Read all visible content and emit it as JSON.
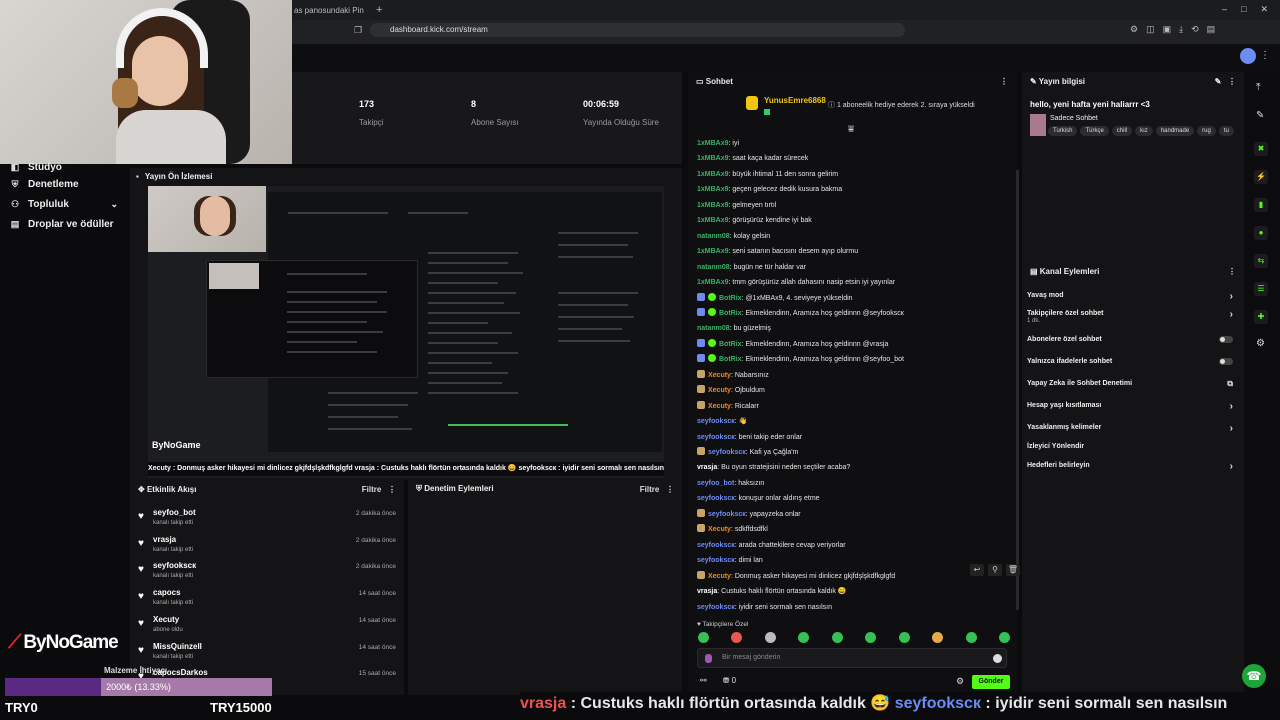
{
  "browser": {
    "tab_title": "as panosundaki Pin",
    "new_tab": "+",
    "url": "dashboard.kick.com/stream",
    "window_controls": [
      "–",
      "□",
      "✕"
    ]
  },
  "nav": {
    "items": [
      {
        "label": "Stüdyo",
        "icon": "studio-icon"
      },
      {
        "label": "Denetleme",
        "icon": "shield-icon"
      },
      {
        "label": "Topluluk",
        "icon": "people-icon"
      },
      {
        "label": "Droplar ve ödüller",
        "icon": "gift-icon"
      }
    ]
  },
  "stats": [
    {
      "value": "173",
      "label": "Takipçi"
    },
    {
      "value": "8",
      "label": "Abone Sayısı"
    },
    {
      "value": "00:06:59",
      "label": "Yayında Olduğu Süre"
    }
  ],
  "preview": {
    "title": "Yayın Ön İzlemesi",
    "logo": "ByNoGame",
    "ticker": "Xecuty : Donmuş asker hikayesi mi dinlicez gkjfdşlşkdfkglgfd  vrasja : Custuks haklı flörtün ortasında kaldık 😄  seyfookscк : iyidir seni sormalı sen nasılsın"
  },
  "activity": {
    "title": "Etkinlik Akışı",
    "filter": "Filtre",
    "items": [
      {
        "name": "seyfoo_bot",
        "sub": "kanalı takip etti",
        "time": "2 dakika önce"
      },
      {
        "name": "vrasja",
        "sub": "kanalı takip etti",
        "time": "2 dakika önce"
      },
      {
        "name": "seyfookscк",
        "sub": "kanalı takip etti",
        "time": "2 dakika önce"
      },
      {
        "name": "capocs",
        "sub": "kanalı takip etti",
        "time": "14 saat önce"
      },
      {
        "name": "Xecuty",
        "sub": "abone oldu",
        "time": "14 saat önce"
      },
      {
        "name": "MissQuinzell",
        "sub": "kanalı takip etti",
        "time": "14 saat önce"
      },
      {
        "name": "capocsDarkos",
        "sub": "",
        "time": "15 saat önce"
      }
    ]
  },
  "moderation": {
    "title": "Denetim Eylemleri",
    "filter": "Filtre"
  },
  "goal": {
    "label": "Malzeme İhtiyacı",
    "text": "2000₺ (13.33%)",
    "progress": 0.1333,
    "min": "TRY0",
    "max": "TRY15000"
  },
  "brand": {
    "logo": "ByNoGame",
    "mark": "⟋"
  },
  "chat": {
    "title": "Sohbet",
    "pinned_user": "YunusEmre6868",
    "pinned_msg": "1 aboneelik hediye ederek 2. sıraya yükseldi",
    "messages": [
      {
        "user": "1xMBAx9",
        "color": "u-green",
        "text": "iyi"
      },
      {
        "user": "1xMBAx9",
        "color": "u-green",
        "text": "saat kaça kadar sürecek"
      },
      {
        "user": "1xMBAx9",
        "color": "u-green",
        "text": "büyük ihtimal 11 den sonra gelirim"
      },
      {
        "user": "1xMBAx9",
        "color": "u-green",
        "text": "geçen gelecez dedik kusura bakma"
      },
      {
        "user": "1xMBAx9",
        "color": "u-green",
        "text": "gelmeyen tırtıl"
      },
      {
        "user": "1xMBAx9",
        "color": "u-green",
        "text": "görüşürüz kendine iyi bak"
      },
      {
        "user": "natanm08",
        "color": "u-green",
        "text": "kolay gelsin"
      },
      {
        "user": "1xMBAx9",
        "color": "u-green",
        "text": "seni satanın bacısını desem ayıp olurmu"
      },
      {
        "user": "natanm08",
        "color": "u-green",
        "text": "bugün ne tür haldar var"
      },
      {
        "user": "1xMBAx9",
        "color": "u-green",
        "text": "tmm görüşürüz allah dahasını nasip etsin iyi yayınlar"
      },
      {
        "user": "BotRix",
        "color": "u-green",
        "text": "@1xMBAx9, 4. seviyeye yükseldin",
        "badge": true
      },
      {
        "user": "BotRix",
        "color": "u-green",
        "text": "Ekmeklendinn, Aramıza hoş geldinnn @seyfookscк",
        "badge": true
      },
      {
        "user": "natanm08",
        "color": "u-green",
        "text": "bu güzelmiş"
      },
      {
        "user": "BotRix",
        "color": "u-green",
        "text": "Ekmeklendinn, Aramıza hoş geldinnn @vrasja",
        "badge": true
      },
      {
        "user": "BotRix",
        "color": "u-green",
        "text": "Ekmeklendinn, Aramıza hoş geldinnn @seyfoo_bot",
        "badge": true
      },
      {
        "user": "Xecuty",
        "color": "u-orange",
        "text": "Nabarsınız",
        "crown": true
      },
      {
        "user": "Xecuty",
        "color": "u-orange",
        "text": "Ojbuldum",
        "crown": true
      },
      {
        "user": "Xecuty",
        "color": "u-orange",
        "text": "Ricalarr",
        "crown": true
      },
      {
        "user": "seyfookscк",
        "color": "u-blue",
        "text": "👋"
      },
      {
        "user": "seyfookscк",
        "color": "u-blue",
        "text": "beni takip eder onlar"
      },
      {
        "user": "seyfookscк",
        "color": "u-blue",
        "text": "Kafi ya Çağla'm",
        "crown": true
      },
      {
        "user": "vrasja",
        "color": "u-white",
        "text": "Bu oyun stratejisini neden seçtiler acaba?"
      },
      {
        "user": "seyfoo_bot",
        "color": "u-blue",
        "text": "haksızın"
      },
      {
        "user": "seyfookscк",
        "color": "u-blue",
        "text": "konuşur onlar aldırış etme"
      },
      {
        "user": "seyfookscк",
        "color": "u-blue",
        "text": "yapayzeka onlar",
        "crown": true
      },
      {
        "user": "Xecuty",
        "color": "u-orange",
        "text": "sdkffdsdfkl",
        "crown": true
      },
      {
        "user": "seyfookscк",
        "color": "u-blue",
        "text": "arada chattekilere cevap veriyorlar"
      },
      {
        "user": "seyfookscк",
        "color": "u-blue",
        "text": "dimi lan"
      },
      {
        "user": "Xecuty",
        "color": "u-orange",
        "text": "Donmuş asker hikayesi mi dinlicez gkjfdşlşkdfkglgfd",
        "crown": true
      },
      {
        "user": "vrasja",
        "color": "u-white",
        "text": "Custuks haklı flörtün ortasında kaldık 😄"
      },
      {
        "user": "seyfookscк",
        "color": "u-blue",
        "text": "iyidir seni sormalı sen nasılsın"
      }
    ],
    "emote_label": "♥ Takipçilere Özel",
    "input_placeholder": "Bir mesaj gönderin",
    "send_label": "Gönder",
    "bottom_count": "0",
    "emotes": 10
  },
  "stream_info": {
    "title": "Yayın bilgisi",
    "stream_title": "hello, yeni hafta yeni haliarrr <3",
    "category": "Sadece Sohbet",
    "tags": [
      "Turkish",
      "Türkçe",
      "chill",
      "kız",
      "handmade",
      "rug",
      "tu"
    ]
  },
  "channel_actions": {
    "title": "Kanal Eylemleri",
    "rows": [
      {
        "label": "Yavaş mod",
        "type": "arrow"
      },
      {
        "label": "Takipçilere özel sohbet",
        "sub": "1 dk.",
        "type": "arrow"
      },
      {
        "label": "Abonelere özel sohbet",
        "type": "toggle"
      },
      {
        "label": "Yalnızca ifadelerle sohbet",
        "type": "toggle"
      },
      {
        "label": "Yapay Zeka ile Sohbet Denetimi",
        "type": "link"
      },
      {
        "label": "Hesap yaşı kısıtlaması",
        "type": "arrow"
      },
      {
        "label": "Yasaklanmış kelimeler",
        "type": "arrow"
      },
      {
        "label": "İzleyici Yönlendir",
        "type": "none"
      },
      {
        "label": "Hedefleri belirleyin",
        "type": "arrow"
      }
    ]
  },
  "bottom_ticker": {
    "user1": "vrasja",
    "msg1": " : Custuks haklı flörtün ortasında kaldık 😅  ",
    "user2": "seyfookscк",
    "msg2": " : iyidir seni sormalı sen nasılsın"
  },
  "colors": {
    "accent": "#53fc18",
    "goal_fill": "#5a2a82",
    "goal_bg": "#a57aa8"
  }
}
